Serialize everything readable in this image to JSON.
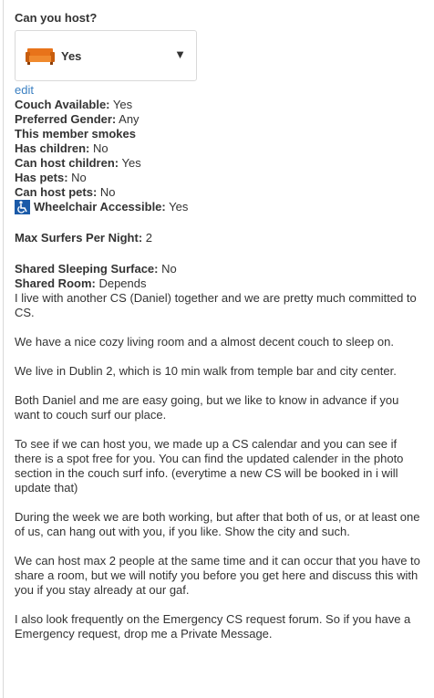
{
  "host": {
    "title": "Can you host?",
    "select_value": "Yes",
    "edit_label": "edit"
  },
  "details": [
    {
      "label": "Couch Available:",
      "value": " Yes"
    },
    {
      "label": "Preferred Gender:",
      "value": " Any"
    },
    {
      "label": "This member smokes",
      "value": ""
    },
    {
      "label": "Has children:",
      "value": " No"
    },
    {
      "label": "Can host children:",
      "value": " Yes"
    },
    {
      "label": "Has pets:",
      "value": " No"
    },
    {
      "label": "Can host pets:",
      "value": " No"
    },
    {
      "label": "Wheelchair Accessible:",
      "value": " Yes"
    }
  ],
  "max_surfers": {
    "label": "Max Surfers Per Night:",
    "value": " 2"
  },
  "sleeping": [
    {
      "label": "Shared Sleeping Surface:",
      "value": " No"
    },
    {
      "label": "Shared Room:",
      "value": " Depends"
    }
  ],
  "paragraphs": [
    "I live with another CS (Daniel) together and we are pretty much committed to CS.",
    "We have a nice cozy living room and a almost decent couch to sleep on.",
    "We live in Dublin 2, which is 10 min walk from temple bar and city center.",
    "Both Daniel and me are easy going, but we like to know in advance if you want to couch surf our place.",
    "To see if we can host you, we made up a CS calendar and you can see if there is a spot free for you. You can find the updated calender in the photo section in the couch surf info. (everytime a new CS will be booked in i will update that)",
    "During the week we are both working, but after that both of us, or at least one of us, can hang out with you, if you like. Show the city and such.",
    "We can host max 2 people at the same time and it can occur that you have to share a room, but we will notify you before you get here and discuss this with you if you stay already at our gaf.",
    "I also look frequently on the Emergency CS request forum. So if you have a Emergency request, drop me a Private Message."
  ],
  "icons": {
    "couch": "couch-icon",
    "wheelchair": "wheelchair-icon",
    "caret": "caret-down-icon"
  },
  "colors": {
    "couch": "#e8731a",
    "link": "#3a7fc1",
    "wheelchair_bg": "#1a5aa8"
  }
}
